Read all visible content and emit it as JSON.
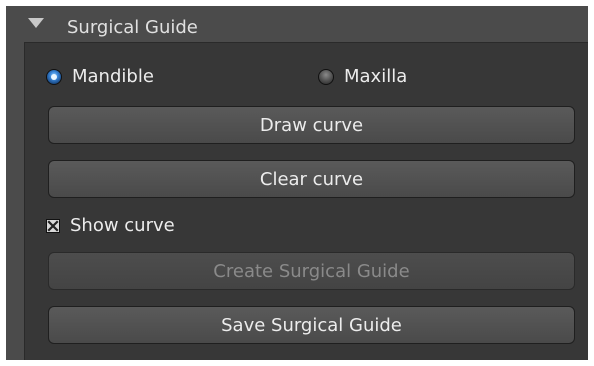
{
  "panel": {
    "title": "Surgical Guide",
    "expanded": true
  },
  "jaw_selection": {
    "options": [
      {
        "label": "Mandible",
        "selected": true
      },
      {
        "label": "Maxilla",
        "selected": false
      }
    ]
  },
  "buttons": {
    "draw_curve": "Draw curve",
    "clear_curve": "Clear curve",
    "create_guide": "Create Surgical Guide",
    "save_guide": "Save Surgical Guide"
  },
  "show_curve": {
    "label": "Show curve",
    "checked": true
  },
  "colors": {
    "panel_bg": "#4b4b4b",
    "inner_bg": "#373737",
    "button_bg": "#545454",
    "radio_accent": "#3a86d8",
    "disabled_text": "#8a8a8a"
  }
}
